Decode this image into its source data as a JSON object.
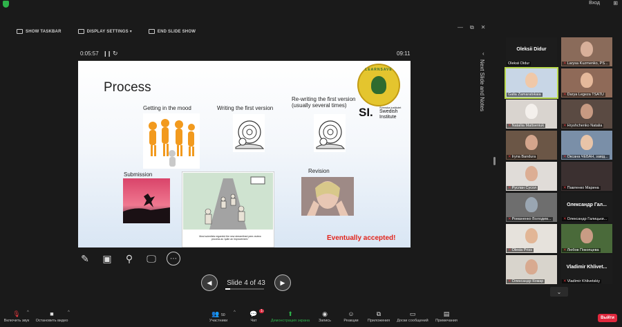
{
  "window": {
    "login_label": "Вход",
    "maximize_glyph": "⊞"
  },
  "sharebar": {
    "show_taskbar": "SHOW TASKBAR",
    "display_settings": "DISPLAY SETTINGS ▾",
    "end_slide_show": "END SLIDE SHOW"
  },
  "window_controls": {
    "minimize": "—",
    "restore": "⧉",
    "close": "✕"
  },
  "presenter": {
    "elapsed": "0:05:57",
    "pause_glyph": "❙❙",
    "reset_glyph": "↻",
    "clock": "09:11"
  },
  "slide": {
    "title": "Process",
    "labels": {
      "mood": "Getting in the mood",
      "first": "Writing the first version",
      "rewrite": "Re-writing the first version\n(usually several times)",
      "submission": "Submission",
      "revision": "Revision"
    },
    "logo_ring_text": "LEARNSAVE",
    "si_mark": "SI.",
    "si_text_top": "Svenska institutet",
    "si_text_bottom": "Swedish\nInstitute",
    "cartoon_caption": "Most scientists regarded the new streamlined peer-review process as 'quite an improvement.'",
    "accepted": "Eventually accepted!"
  },
  "tools": {
    "pen": "✎",
    "shapes": "▣",
    "zoom": "⚲",
    "screen": "🖵",
    "more": "⋯"
  },
  "slide_nav": {
    "prev": "◀",
    "next": "▶",
    "label": "Slide 4 of 43",
    "current": 4,
    "total": 43
  },
  "notes_panel": {
    "label": "Next Slide and Notes",
    "collapse": "‹"
  },
  "participants": [
    {
      "name": "Oleksii Didur",
      "big_name": "Oleksii Didur",
      "muted": false
    },
    {
      "name": "Larysa Kuzmenko, PS...",
      "muted": true
    },
    {
      "name": "Galia Zamaratskaia",
      "muted": false
    },
    {
      "name": "Darya Legeza TSATU",
      "muted": true
    },
    {
      "name": "Nataliia Mattseniuk",
      "muted": true
    },
    {
      "name": "Hryshchenko Natalia",
      "muted": true
    },
    {
      "name": "Iryna Bandura",
      "muted": true
    },
    {
      "name": "Оксана ЧЕБАН, завід...",
      "muted": true
    },
    {
      "name": "Руслан Сусол",
      "muted": true
    },
    {
      "name": "Павленко Марина",
      "muted": true
    },
    {
      "name": "Романенко Володим...",
      "muted": true
    },
    {
      "name": "Олександр Галицьки...",
      "big_name": "Олександр Гал...",
      "muted": true
    },
    {
      "name": "Olesia Priss",
      "muted": true
    },
    {
      "name": "Любов Покопцева",
      "muted": true
    },
    {
      "name": "Олександр Комар",
      "muted": true
    },
    {
      "name": "Vladimir Khlivetskiy",
      "big_name": "Vladimir Khlivet...",
      "muted": true
    }
  ],
  "gallery_scroll": "⌄",
  "bottombar": {
    "audio": "Включить звук",
    "video": "Остановить видео",
    "participants": "Участники",
    "participants_count": "50",
    "chat": "Чат",
    "chat_badge": "1",
    "share": "Демонстрация экрана",
    "record": "Запись",
    "reactions": "Реакции",
    "apps": "Приложения",
    "whiteboards": "Доски сообщений",
    "notes": "Примечания",
    "leave": "Выйти"
  },
  "colors": {
    "accent_green": "#2eb34a",
    "leave_red": "#e0283d",
    "accepted_red": "#e2231a",
    "active_speaker": "#b8d84a"
  }
}
